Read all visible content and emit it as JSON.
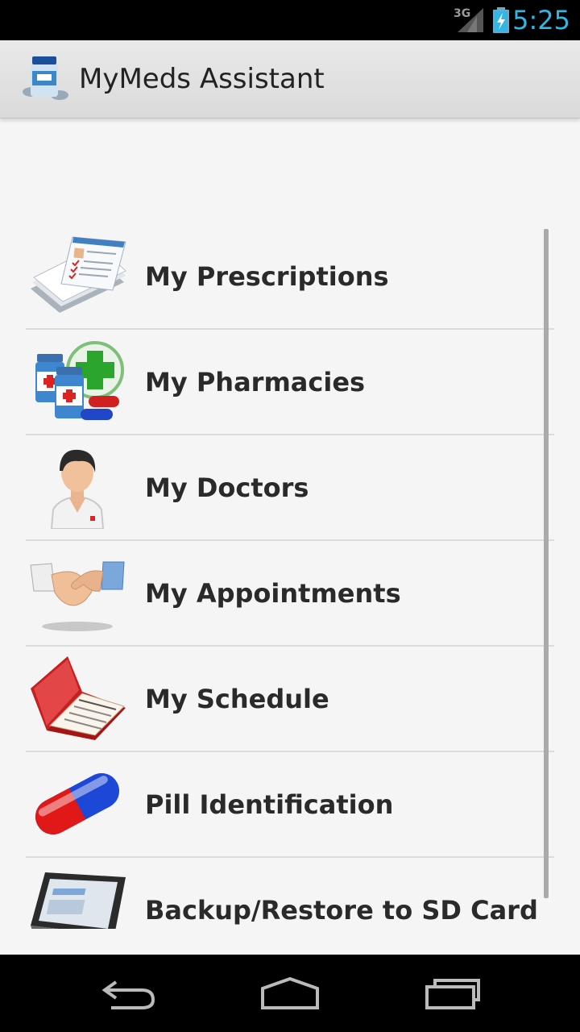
{
  "status_bar": {
    "network": "3G",
    "time": "5:25",
    "accent": "#33b5e5"
  },
  "action_bar": {
    "title": "MyMeds Assistant",
    "icon": "medicine-bottle-icon"
  },
  "menu": {
    "items": [
      {
        "label": "My Prescriptions",
        "icon": "prescription-notes-icon"
      },
      {
        "label": "My Pharmacies",
        "icon": "pharmacy-bottles-icon"
      },
      {
        "label": "My Doctors",
        "icon": "doctor-icon"
      },
      {
        "label": "My Appointments",
        "icon": "handshake-icon"
      },
      {
        "label": "My Schedule",
        "icon": "schedule-book-icon"
      },
      {
        "label": "Pill Identification",
        "icon": "pill-capsule-icon"
      },
      {
        "label": "Backup/Restore to SD Card",
        "icon": "tablet-device-icon"
      }
    ]
  },
  "nav_bar": {
    "buttons": [
      "back-icon",
      "home-icon",
      "recent-apps-icon"
    ]
  }
}
